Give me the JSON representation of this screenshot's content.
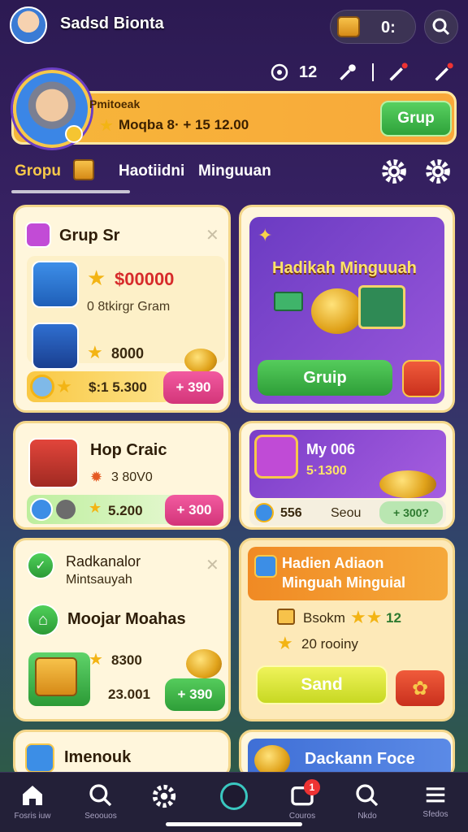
{
  "header": {
    "username": "Sadsd Bionta",
    "coin_value": "0:"
  },
  "stats": {
    "count": "12"
  },
  "profile": {
    "title": "Pmitoeak",
    "subtitle": "Moqba 8· + 15 12.00",
    "button": "Grup"
  },
  "tabs": [
    {
      "label": "Gropu"
    },
    {
      "label": "Haotiidni"
    },
    {
      "label": "Minguuan"
    }
  ],
  "cards": {
    "grup": {
      "title": "Grup Sr",
      "row1_value": "$00000",
      "row1_sub": "0 8tkirgr Gram",
      "row2_value": "8000",
      "footer_value": "$:1 5.300",
      "footer_button": "+ 390"
    },
    "hadikah": {
      "title": "Hadikah Minguuah",
      "button": "Gruip"
    },
    "shop": {
      "title": "Hop Craic",
      "sub": "3 80V0",
      "footer_value": "5.200",
      "footer_button": "+ 300"
    },
    "my": {
      "title": "My 006",
      "sub": "5·1300",
      "footer_left": "556",
      "footer_mid": "Seou",
      "footer_right": "+ 300?"
    },
    "rank": {
      "title": "Radkanalor",
      "sub": "Mintsauyah",
      "headline": "Moojar Moahas",
      "value1": "8300",
      "value2": "23.001",
      "footer_button": "+ 390"
    },
    "hadien": {
      "title": "Hadien Adiaon Minguah Minguial",
      "line1": "Bsokm",
      "line1_num": "12",
      "line2": "20 rooiny",
      "send_button": "Sand"
    },
    "bottom_left": {
      "title": "Imenouk"
    },
    "bottom_right": {
      "title": "Dackann Foce"
    }
  },
  "nav": [
    {
      "label": "Fosris iuw"
    },
    {
      "label": "Seoouos"
    },
    {
      "label": ""
    },
    {
      "label": ""
    },
    {
      "label": "Couros",
      "badge": "1"
    },
    {
      "label": "Nkdo"
    },
    {
      "label": "Sfedos"
    }
  ],
  "colors": {
    "accent": "#f7c84a",
    "green": "#3cb449",
    "pink": "#e3498b",
    "purple": "#8a47d0"
  }
}
